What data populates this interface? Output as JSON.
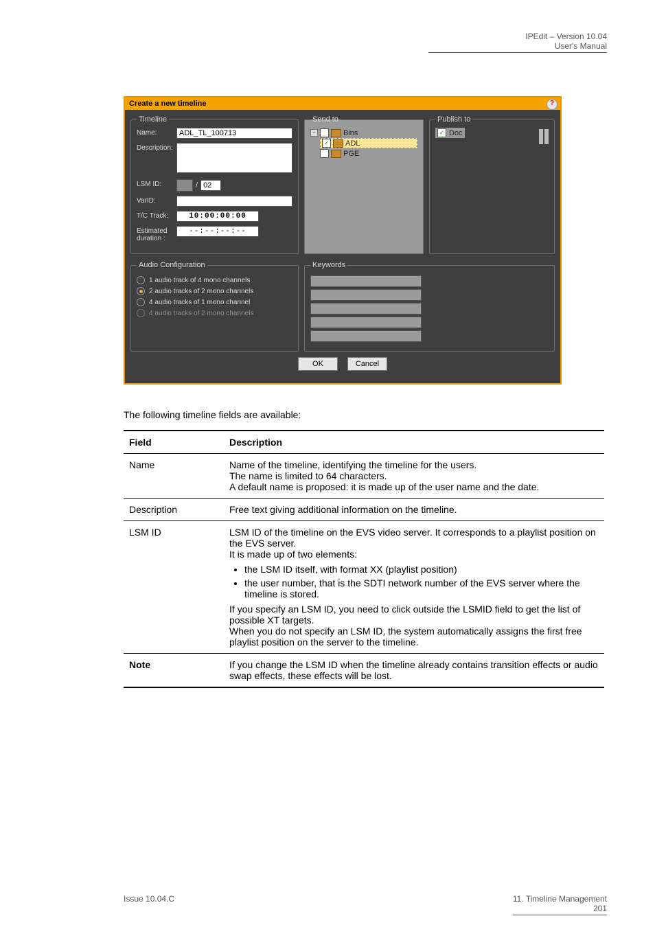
{
  "header": {
    "line1": "IPEdit – Version 10.04",
    "line2": "User's Manual"
  },
  "dialog": {
    "title": "Create a new timeline",
    "timeline": {
      "legend": "Timeline",
      "name_label": "Name:",
      "name_value": "ADL_TL_100713",
      "description_label": "Description:",
      "description_value": "",
      "lsmid_label": "LSM ID:",
      "lsmid_slash": "/",
      "lsmid_value": "02",
      "varid_label": "VarID:",
      "varid_value": "",
      "tctrack_label": "T/C Track:",
      "tctrack_value": "10:00:00:00",
      "estdur_label": "Estimated duration :",
      "estdur_value": "--:--:--:--"
    },
    "sendto": {
      "legend": "Send to",
      "root": "Bins",
      "item1": "ADL",
      "item2": "PGE"
    },
    "publishto": {
      "legend": "Publish to",
      "item1": "Doc"
    },
    "audio": {
      "legend": "Audio Configuration",
      "opt1": "1 audio track of 4 mono channels",
      "opt2": "2 audio tracks of 2 mono channels",
      "opt3": "4 audio tracks of 1 mono channel",
      "opt4": "4 audio tracks of 2 mono channels"
    },
    "keywords": {
      "legend": "Keywords"
    },
    "buttons": {
      "ok": "OK",
      "cancel": "Cancel"
    }
  },
  "intro": "The following timeline fields are available:",
  "table": {
    "head_field": "Field",
    "head_desc": "Description",
    "rows": [
      {
        "field": "Name",
        "desc": "Name of the timeline, identifying the timeline for the users.\nThe name is limited to 64 characters.\nA default name is proposed: it is made up of the user name and the date."
      },
      {
        "field": "Description",
        "desc": "Free text giving additional information on the timeline."
      },
      {
        "field": "LSM ID",
        "desc": "LSM ID of the timeline on the EVS video server. It corresponds to a playlist position on the EVS server.\nIt is made up of two elements:",
        "bullets": [
          "the LSM ID itself, with format XX (playlist position)",
          "the user number, that is the SDTI network number of the EVS server where the timeline is stored."
        ],
        "desc2": "If you specify an LSM ID, you need to click outside the LSMID field to get the list of possible XT targets.\nWhen you do not specify an LSM ID, the system automatically assigns the first free playlist position on the server to the timeline."
      },
      {
        "field": "Note",
        "desc": "If you change the LSM ID when the timeline already contains transition effects or audio swap effects, these effects will be lost."
      }
    ]
  },
  "footer": {
    "left": "Issue 10.04.C",
    "right_line1": "11. Timeline Management",
    "right_line2": "201"
  }
}
